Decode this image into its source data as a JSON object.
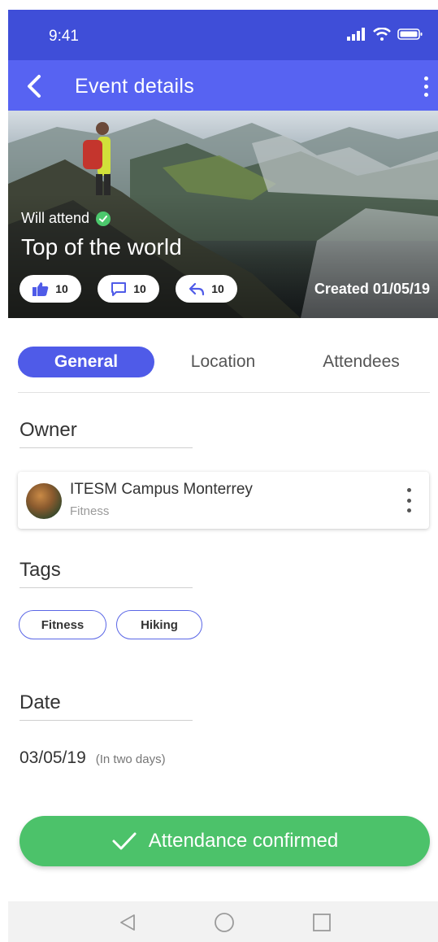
{
  "status_bar": {
    "time": "9:41"
  },
  "app_bar": {
    "title": "Event details"
  },
  "event": {
    "attendance_label": "Will attend",
    "title": "Top of the world",
    "likes": "10",
    "comments": "10",
    "shares": "10",
    "created": "Created 01/05/19"
  },
  "tabs": [
    {
      "label": "General",
      "active": true
    },
    {
      "label": "Location",
      "active": false
    },
    {
      "label": "Attendees",
      "active": false
    }
  ],
  "owner": {
    "section_title": "Owner",
    "name": "ITESM Campus Monterrey",
    "category": "Fitness"
  },
  "tags": {
    "section_title": "Tags",
    "items": [
      "Fitness",
      "Hiking"
    ]
  },
  "date": {
    "section_title": "Date",
    "value": "03/05/19",
    "note": "(In two days)"
  },
  "confirm_button": {
    "label": "Attendance confirmed"
  },
  "colors": {
    "status_bar": "#3f4ed8",
    "app_bar": "#5763f2",
    "accent": "#4f5be8",
    "confirm": "#4cc26a",
    "check": "#4cc86d"
  },
  "icons": {
    "back": "chevron-left-icon",
    "more": "more-vertical-icon",
    "like": "thumbs-up-icon",
    "comment": "comment-icon",
    "share": "reply-icon",
    "check": "check-icon",
    "nav_back": "triangle-back-icon",
    "nav_home": "circle-home-icon",
    "nav_recent": "square-recent-icon"
  }
}
